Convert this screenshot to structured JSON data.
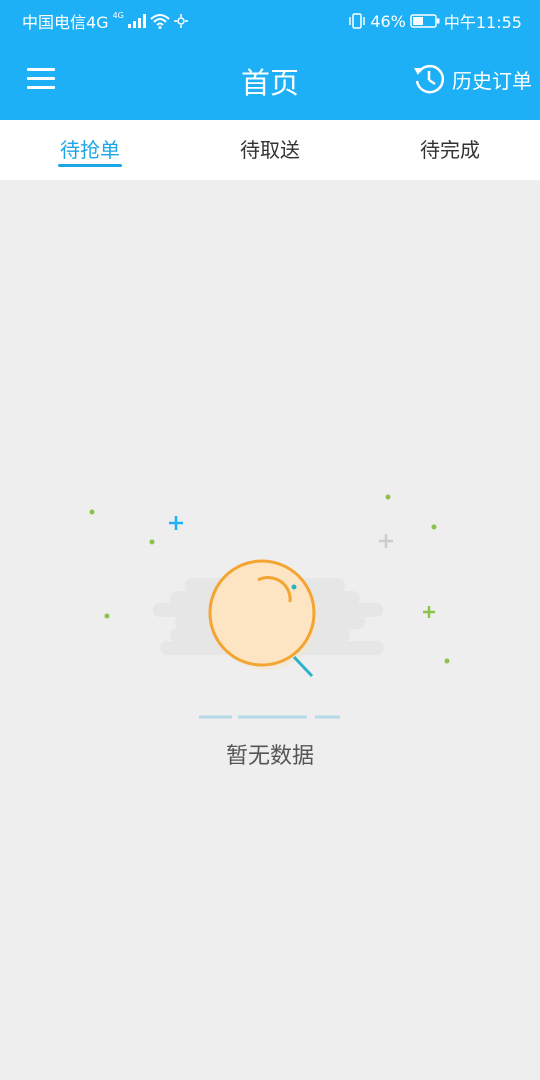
{
  "status_bar": {
    "carrier": "中国电信4G",
    "network_badge": "4G",
    "battery": "46%",
    "time": "中午11:55"
  },
  "app_bar": {
    "title": "首页",
    "history_label": "历史订单"
  },
  "tabs": [
    {
      "label": "待抢单",
      "active": true
    },
    {
      "label": "待取送",
      "active": false
    },
    {
      "label": "待完成",
      "active": false
    }
  ],
  "empty_state": {
    "message": "暂无数据"
  },
  "colors": {
    "primary": "#1eb0f6",
    "tab_active": "#1da6e6",
    "background": "#eeeeee"
  }
}
